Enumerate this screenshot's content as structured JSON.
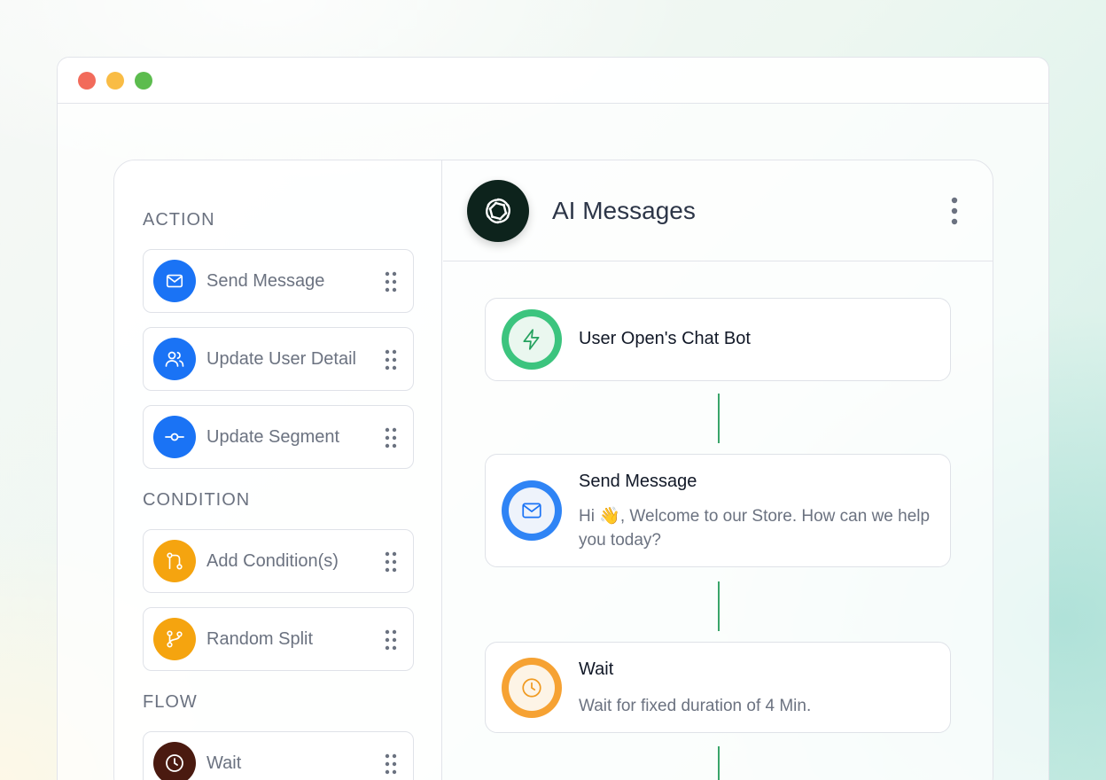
{
  "window": {
    "controls": [
      "close",
      "minimize",
      "maximize"
    ],
    "colors": {
      "close": "#f26b5b",
      "minimize": "#f9bc45",
      "maximize": "#5cbc4e"
    }
  },
  "sidebar": {
    "sections": {
      "action": "ACTION",
      "condition": "CONDITION",
      "flow": "FLOW"
    },
    "items": [
      {
        "label": "Send Message",
        "icon": "mail-icon",
        "color": "#1a73f5"
      },
      {
        "label": "Update User Detail",
        "icon": "users-icon",
        "color": "#1a73f5"
      },
      {
        "label": "Update Segment",
        "icon": "segment-icon",
        "color": "#1a73f5"
      },
      {
        "label": "Add Condition(s)",
        "icon": "condition-icon",
        "color": "#f5a40f"
      },
      {
        "label": "Random Split",
        "icon": "split-icon",
        "color": "#f5a40f"
      },
      {
        "label": "Wait",
        "icon": "clock-icon",
        "color": "#4a1a10"
      }
    ]
  },
  "header": {
    "title": "AI Messages",
    "logo_icon": "openai-logo-icon"
  },
  "flow": {
    "nodes": [
      {
        "title": "User Open's Chat Bot",
        "description": "",
        "icon": "lightning-icon",
        "ring": "#3cc47e"
      },
      {
        "title": "Send Message",
        "description": "Hi 👋, Welcome to our Store. How can we help you today?",
        "icon": "mail-icon",
        "ring": "#2f84f5"
      },
      {
        "title": "Wait",
        "description": "Wait for fixed duration of 4 Min.",
        "icon": "clock-icon",
        "ring": "#f6a233"
      }
    ]
  }
}
